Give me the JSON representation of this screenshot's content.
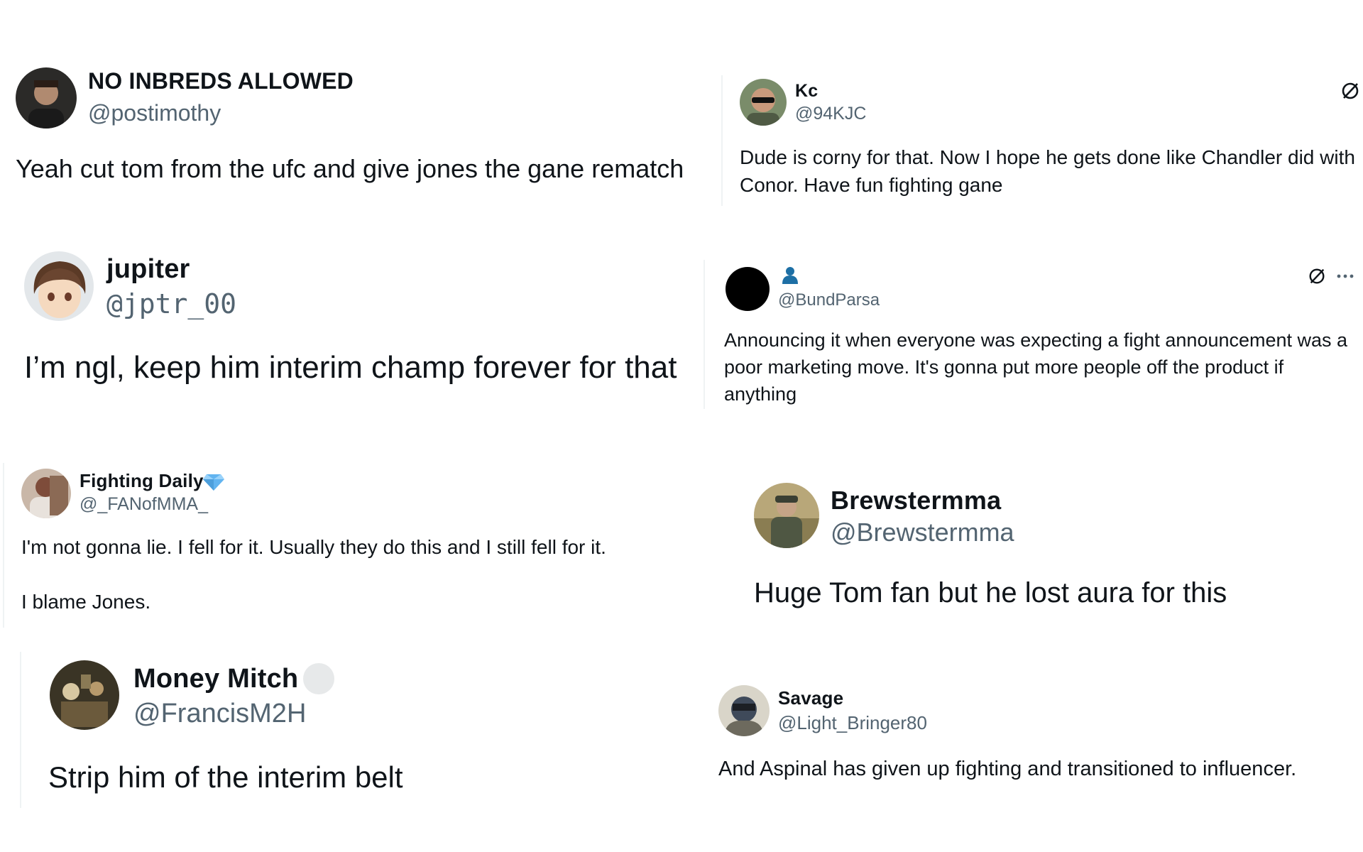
{
  "tweets": [
    {
      "name": "NO INBREDS ALLOWED",
      "handle": "@postimothy",
      "text": "Yeah cut tom from the ufc and give jones the gane rematch"
    },
    {
      "name": "Kc",
      "handle": "@94KJC",
      "text": "Dude is corny for that. Now I hope he gets done like Chandler did with Conor. Have fun fighting gane"
    },
    {
      "name": "jupiter",
      "handle": "@jptr_00",
      "text": "I’m ngl, keep him interim champ forever for that"
    },
    {
      "name": "",
      "handle": "@BundParsa",
      "text": "Announcing it when everyone was expecting a fight announcement was a poor marketing move. It's gonna put more people off the product if anything"
    },
    {
      "name": "Fighting Daily",
      "handle": "@_FANofMMA_",
      "text": "I'm not gonna lie. I fell for it. Usually they do this and I still fell for it.",
      "text2": "I blame Jones."
    },
    {
      "name": "Brewstermma",
      "handle": "@Brewstermma",
      "text": "Huge Tom fan but he lost aura for this"
    },
    {
      "name": "Money Mitch",
      "handle": "@FrancisM2H",
      "text": "Strip him of the interim belt"
    },
    {
      "name": "Savage",
      "handle": "@Light_Bringer80",
      "text": "And Aspinal has given up fighting and transitioned to influencer."
    }
  ],
  "icons": {
    "grok": "grok-icon",
    "more": "more-icon",
    "person": "person-icon",
    "verified": "diamond-badge-icon",
    "pending": "badge-placeholder-icon"
  },
  "colors": {
    "handle": "#536471",
    "text": "#0f1419",
    "badge": "#62b4f0"
  }
}
